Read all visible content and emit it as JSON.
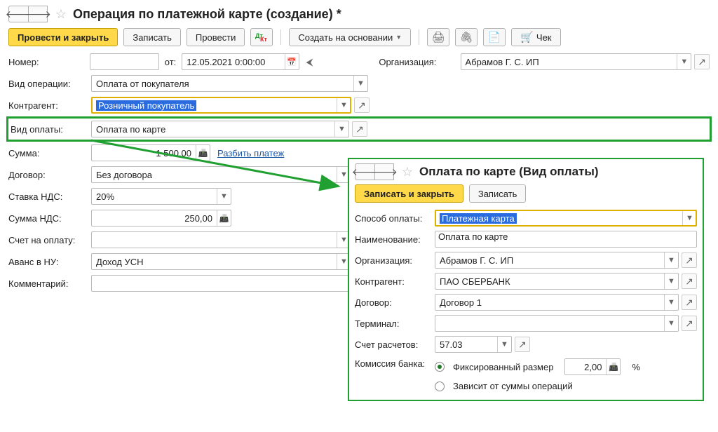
{
  "main": {
    "title": "Операция по платежной карте (создание) *",
    "toolbar": {
      "post_close": "Провести и закрыть",
      "save": "Записать",
      "post": "Провести",
      "dk_icon": "debit-credit-icon",
      "create_basis": "Создать на основании",
      "cheque": "Чек"
    },
    "labels": {
      "number": "Номер:",
      "from": "от:",
      "date": "12.05.2021 0:00:00",
      "org": "Организация:",
      "org_val": "Абрамов Г. С. ИП",
      "operation_type": "Вид операции:",
      "operation_type_val": "Оплата от покупателя",
      "contragent": "Контрагент:",
      "contragent_val": "Розничный покупатель",
      "payment_type": "Вид оплаты:",
      "payment_type_val": "Оплата по карте",
      "amount": "Сумма:",
      "amount_val": "1 500,00",
      "split": "Разбить платеж",
      "contract": "Договор:",
      "contract_val": "Без договора",
      "vat_rate": "Ставка НДС:",
      "vat_rate_val": "20%",
      "vat_amount": "Сумма НДС:",
      "vat_amount_val": "250,00",
      "invoice": "Счет на оплату:",
      "advance": "Аванс в НУ:",
      "advance_val": "Доход УСН",
      "comment": "Комментарий:"
    }
  },
  "popup": {
    "title": "Оплата по карте (Вид оплаты)",
    "toolbar": {
      "save_close": "Записать и закрыть",
      "save": "Записать"
    },
    "labels": {
      "payment_method": "Способ оплаты:",
      "payment_method_val": "Платежная карта",
      "name": "Наименование:",
      "name_val": "Оплата по карте",
      "org": "Организация:",
      "org_val": "Абрамов Г. С. ИП",
      "contragent": "Контрагент:",
      "contragent_val": "ПАО СБЕРБАНК",
      "contract": "Договор:",
      "contract_val": "Договор 1",
      "terminal": "Терминал:",
      "account": "Счет расчетов:",
      "account_val": "57.03",
      "commission": "Комиссия банка:",
      "opt_fixed": "Фиксированный размер",
      "opt_fixed_val": "2,00",
      "pct": "%",
      "opt_depends": "Зависит от суммы операций"
    }
  }
}
